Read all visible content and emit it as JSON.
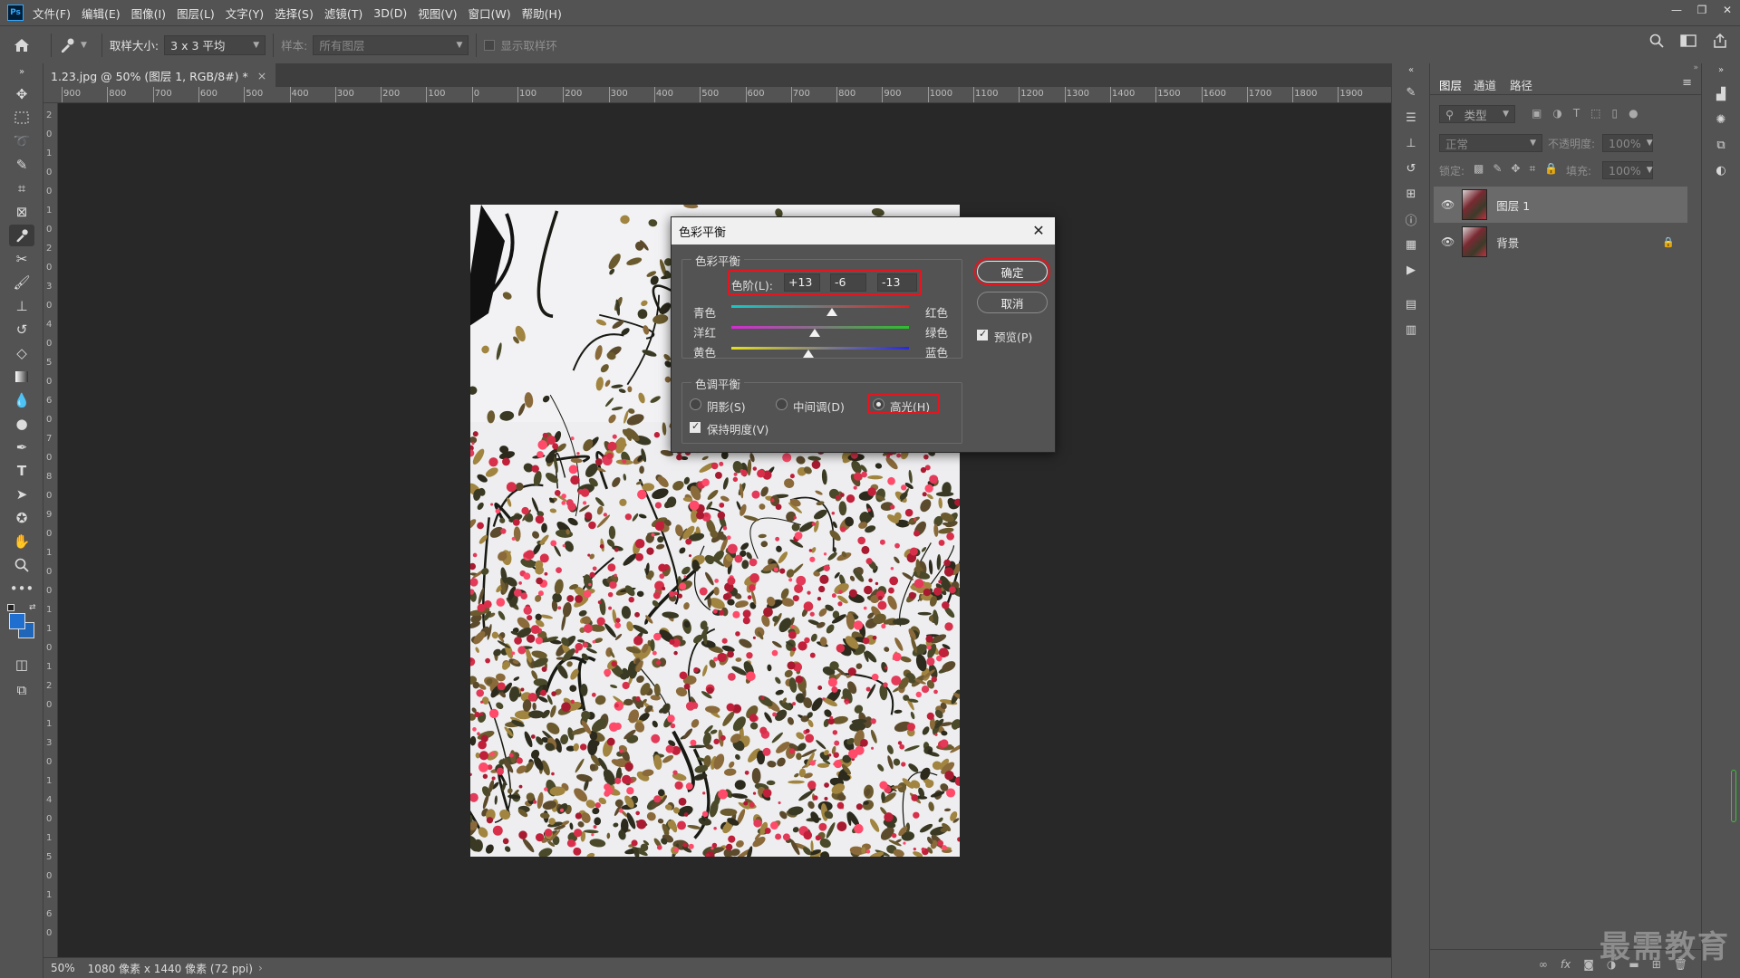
{
  "menubar": {
    "logo": "Ps",
    "items": [
      "文件(F)",
      "编辑(E)",
      "图像(I)",
      "图层(L)",
      "文字(Y)",
      "选择(S)",
      "滤镜(T)",
      "3D(D)",
      "视图(V)",
      "窗口(W)",
      "帮助(H)"
    ]
  },
  "window_controls": {
    "minimize": "—",
    "restore": "❐",
    "close": "✕"
  },
  "options_bar": {
    "sample_size_label": "取样大小:",
    "sample_size_value": "3 x 3 平均",
    "sample_label": "样本:",
    "sample_value": "所有图层",
    "show_ring_label": "显示取样环"
  },
  "document": {
    "tab_title": "1.23.jpg @ 50% (图层 1, RGB/8#) *",
    "tab_close": "×",
    "zoom": "50%",
    "info": "1080 像素 x 1440 像素 (72 ppi)"
  },
  "ruler_h_labels": [
    "900",
    "800",
    "700",
    "600",
    "500",
    "400",
    "300",
    "200",
    "100",
    "0",
    "100",
    "200",
    "300",
    "400",
    "500",
    "600",
    "700",
    "800",
    "900",
    "1000",
    "1100",
    "1200",
    "1300",
    "1400",
    "1500",
    "1600",
    "1700",
    "1800",
    "1900"
  ],
  "ruler_v_labels": [
    "2",
    "0",
    "1",
    "0",
    "0",
    "1",
    "0",
    "2",
    "0",
    "3",
    "0",
    "4",
    "0",
    "5",
    "0",
    "6",
    "0",
    "7",
    "0",
    "8",
    "0",
    "9",
    "0",
    "1",
    "0",
    "0",
    "1",
    "1",
    "0",
    "1",
    "2",
    "0",
    "1",
    "3",
    "0",
    "1",
    "4",
    "0",
    "1",
    "5",
    "0",
    "1",
    "6",
    "0"
  ],
  "color_balance_dialog": {
    "title": "色彩平衡",
    "close": "✕",
    "group_color_balance": "色彩平衡",
    "levels_label": "色阶(L):",
    "levels": [
      "+13",
      "-6",
      "-13"
    ],
    "sliders": [
      {
        "left": "青色",
        "right": "红色",
        "value": 13,
        "from": "#13c9c9",
        "to": "#e02020"
      },
      {
        "left": "洋红",
        "right": "绿色",
        "value": -6,
        "from": "#d22cd2",
        "to": "#2cc02c"
      },
      {
        "left": "黄色",
        "right": "蓝色",
        "value": -13,
        "from": "#e6e01c",
        "to": "#2828e0"
      }
    ],
    "group_tone_balance": "色调平衡",
    "tones": [
      {
        "label": "阴影(S)",
        "selected": false
      },
      {
        "label": "中间调(D)",
        "selected": false
      },
      {
        "label": "高光(H)",
        "selected": true
      }
    ],
    "preserve_luminosity_label": "保持明度(V)",
    "preserve_luminosity": true,
    "ok_label": "确定",
    "cancel_label": "取消",
    "preview_label": "预览(P)",
    "preview": true,
    "highlight_color": "#e4151f"
  },
  "layers_panel": {
    "tabs": [
      "图层",
      "通道",
      "路径"
    ],
    "filter_placeholder": "类型",
    "blend_mode": "正常",
    "opacity_label": "不透明度:",
    "opacity_value": "100%",
    "lock_label": "锁定:",
    "fill_label": "填充:",
    "fill_value": "100%",
    "layers": [
      {
        "name": "图层 1",
        "selected": true,
        "locked": false
      },
      {
        "name": "背景",
        "selected": false,
        "locked": true
      }
    ]
  },
  "watermark": "最需教育"
}
